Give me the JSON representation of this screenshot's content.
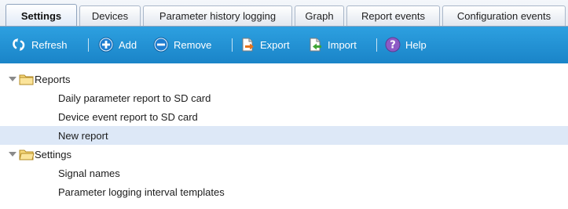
{
  "tabs": [
    {
      "label": "Settings",
      "active": true
    },
    {
      "label": "Devices",
      "active": false
    },
    {
      "label": "Parameter history logging",
      "active": false
    },
    {
      "label": "Graph",
      "active": false
    },
    {
      "label": "Report events",
      "active": false
    },
    {
      "label": "Configuration events",
      "active": false
    }
  ],
  "toolbar": {
    "refresh_label": "Refresh",
    "add_label": "Add",
    "remove_label": "Remove",
    "export_label": "Export",
    "import_label": "Import",
    "help_label": "Help"
  },
  "tree": {
    "groups": [
      {
        "label": "Reports",
        "expanded": true,
        "children": [
          {
            "label": "Daily parameter report to SD card",
            "selected": false
          },
          {
            "label": "Device event report to SD card",
            "selected": false
          },
          {
            "label": "New report",
            "selected": true
          }
        ]
      },
      {
        "label": "Settings",
        "expanded": true,
        "children": [
          {
            "label": "Signal names",
            "selected": false
          },
          {
            "label": "Parameter logging interval templates",
            "selected": false
          }
        ]
      }
    ]
  },
  "colors": {
    "toolbar": "#1e8fd3",
    "selected_row": "#dde8f7",
    "tab_active_text": "#111111"
  }
}
